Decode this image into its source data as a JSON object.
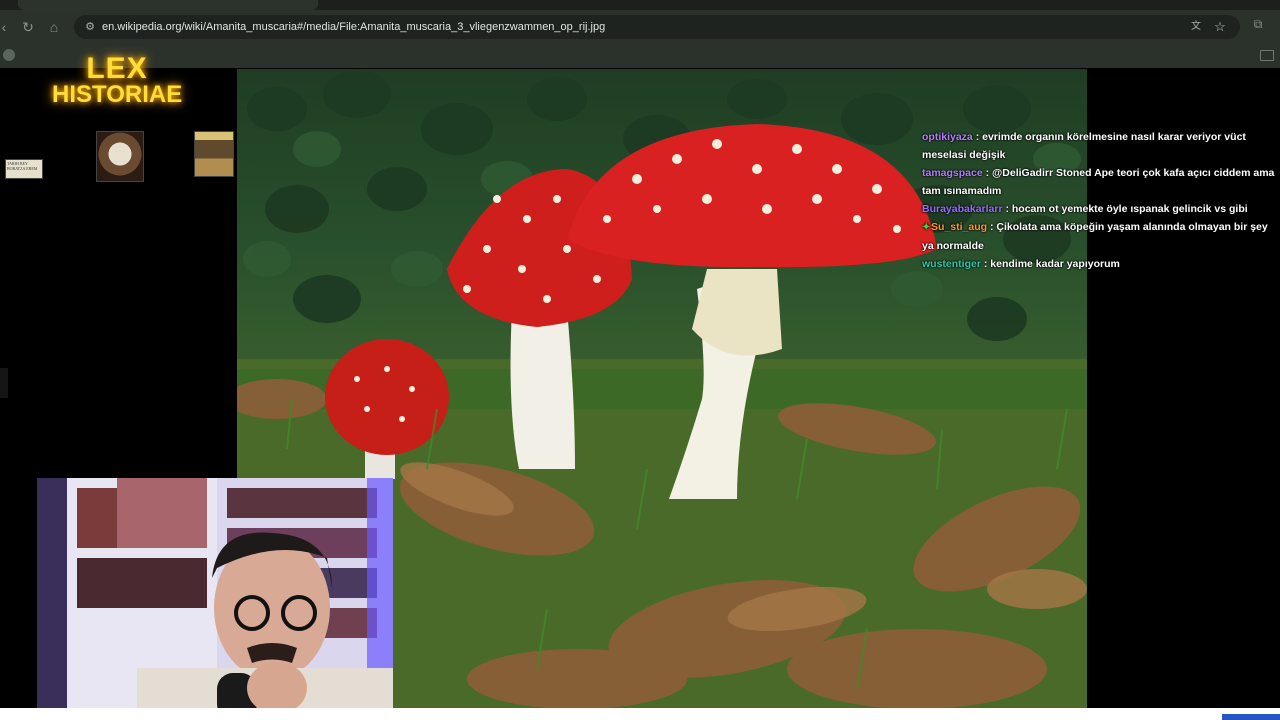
{
  "browser": {
    "url": "en.wikipedia.org/wiki/Amanita_muscaria#/media/File:Amanita_muscaria_3_vliegenzwammen_op_rij.jpg",
    "icons": [
      "back-icon",
      "forward-icon",
      "reload-icon",
      "home-icon",
      "site-info-icon",
      "translate-icon",
      "bookmark-star-icon",
      "extensions-icon",
      "apps-icon",
      "folder-icon"
    ]
  },
  "overlay": {
    "logo_line1": "LEX",
    "logo_line2": "HISTORIAE",
    "book1_text": "TARIH BEY BORATZA EREM"
  },
  "chat": {
    "messages": [
      {
        "user": "optikiyaza",
        "color": "#b57bff",
        "text": " : evrimde organın körelmesine nasıl karar veriyor vüct meselasi değişik"
      },
      {
        "user": "tamagspace",
        "color": "#b57bff",
        "text": " : @DeliGadirr Stoned Ape teori çok kafa açıcı ciddem ama tam ısınamadım"
      },
      {
        "user": "Burayabakarlarr",
        "color": "#9b6bff",
        "text": " : hocam ot yemekte öyle ıspanak gelincik vs gibi"
      },
      {
        "user": "Su_sti_aug",
        "color": "#ff9a1f",
        "text": " : Çikolata ama köpeğin yaşam alanında olmayan bir şey ya normalde",
        "badge": true
      },
      {
        "user": "wustentiger",
        "color": "#33c7a7",
        "text": " : kendime kadar yapıyorum"
      }
    ]
  },
  "colors": {
    "logo": "#ffde3a",
    "mushroom_cap": "#d21d1c",
    "chrome_bg": "#2b322c"
  }
}
